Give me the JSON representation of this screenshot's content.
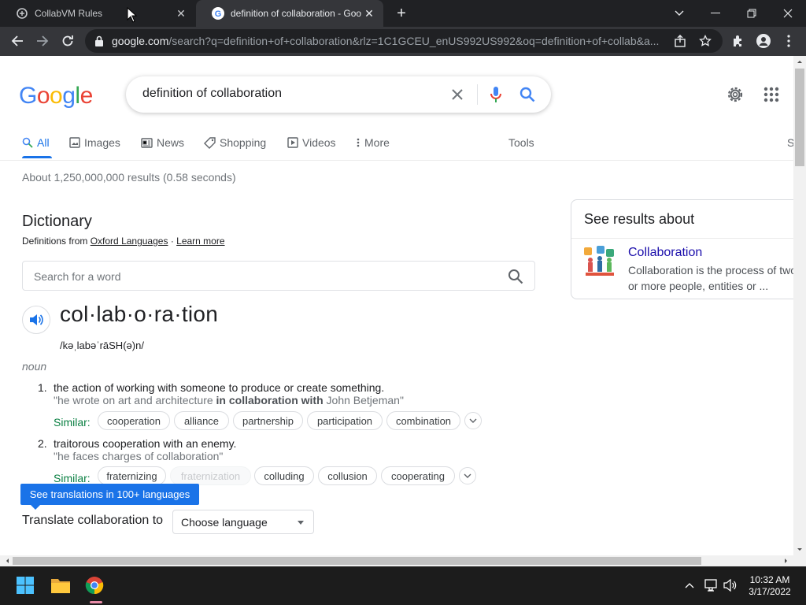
{
  "browser": {
    "tabs": [
      {
        "title": "CollabVM Rules"
      },
      {
        "title": "definition of collaboration - Goo"
      }
    ],
    "url_host": "google.com",
    "url_rest": "/search?q=definition+of+collaboration&rlz=1C1GCEU_enUS992US992&oq=definition+of+collab&a..."
  },
  "search": {
    "logo": "Google",
    "query": "definition of collaboration",
    "tabs": [
      "All",
      "Images",
      "News",
      "Shopping",
      "Videos",
      "More"
    ],
    "tools": "Tools",
    "settings_partial": "S",
    "stats": "About 1,250,000,000 results (0.58 seconds)"
  },
  "dictionary": {
    "title": "Dictionary",
    "source_prefix": "Definitions from",
    "source_link": "Oxford Languages",
    "separator": "·",
    "learn_more": "Learn more",
    "search_placeholder": "Search for a word",
    "headword": "col·lab·o·ra·tion",
    "phonetic": "/kəˌlabəˈrāSH(ə)n/",
    "part_of_speech": "noun",
    "similar_label": "Similar:",
    "senses": [
      {
        "num": "1.",
        "definition": "the action of working with someone to produce or create something.",
        "example_pre": "\"he wrote on art and architecture ",
        "example_bold": "in collaboration with",
        "example_post": " John Betjeman\"",
        "similar": [
          "cooperation",
          "alliance",
          "partnership",
          "participation",
          "combination"
        ]
      },
      {
        "num": "2.",
        "definition": "traitorous cooperation with an enemy.",
        "example": "\"he faces charges of collaboration\"",
        "similar": [
          "fraternizing",
          "fraternization",
          "colluding",
          "collusion",
          "cooperating"
        ]
      }
    ],
    "translations_tooltip": "See translations in 100+ languages",
    "translate_label": "Translate collaboration to",
    "choose_language": "Choose language"
  },
  "knowledge_panel": {
    "title": "See results about",
    "entity": "Collaboration",
    "description": "Collaboration is the process of two or more people, entities or ..."
  },
  "taskbar": {
    "time": "10:32 AM",
    "date": "3/17/2022"
  },
  "colors": {
    "accent_blue": "#1a73e8",
    "link": "#1a0dab",
    "similar_green": "#0b8043"
  }
}
